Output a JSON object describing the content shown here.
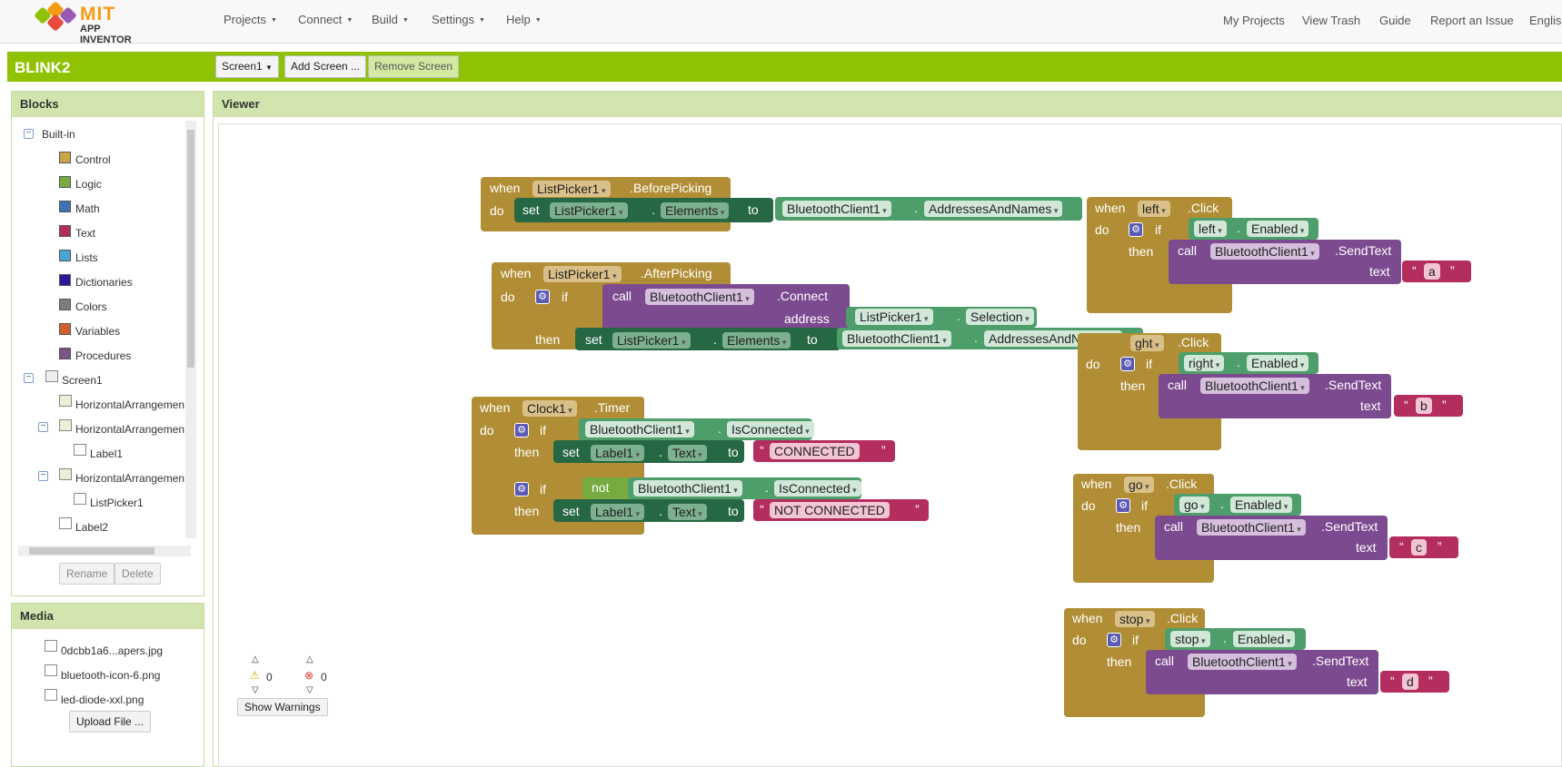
{
  "app": {
    "logo_line1": "MIT",
    "logo_line2": "APP INVENTOR"
  },
  "menu": [
    "Projects",
    "Connect",
    "Build",
    "Settings",
    "Help"
  ],
  "right_links": [
    "My Projects",
    "View Trash",
    "Guide",
    "Report an Issue",
    "English"
  ],
  "project": {
    "name": "BLINK2",
    "screen_select": "Screen1",
    "add_screen": "Add Screen ...",
    "remove_screen": "Remove Screen"
  },
  "blocks_panel": {
    "title": "Blocks",
    "builtin": "Built-in",
    "categories": [
      {
        "label": "Control",
        "color": "#c9a545"
      },
      {
        "label": "Logic",
        "color": "#77ab41"
      },
      {
        "label": "Math",
        "color": "#3f71b5"
      },
      {
        "label": "Text",
        "color": "#b32d5e"
      },
      {
        "label": "Lists",
        "color": "#49a6d4"
      },
      {
        "label": "Dictionaries",
        "color": "#2d1799"
      },
      {
        "label": "Colors",
        "color": "#7d7d7d"
      },
      {
        "label": "Variables",
        "color": "#d05f2d"
      },
      {
        "label": "Procedures",
        "color": "#7c5385"
      }
    ],
    "components": [
      {
        "label": "Screen1"
      },
      {
        "label": "HorizontalArrangemen"
      },
      {
        "label": "HorizontalArrangemen"
      },
      {
        "label": "Label1"
      },
      {
        "label": "HorizontalArrangemen"
      },
      {
        "label": "ListPicker1"
      },
      {
        "label": "Label2"
      }
    ],
    "rename": "Rename",
    "delete": "Delete"
  },
  "media_panel": {
    "title": "Media",
    "files": [
      "0dcbb1a6...apers.jpg",
      "bluetooth-icon-6.png",
      "led-diode-xxl.png"
    ],
    "upload": "Upload File ..."
  },
  "viewer": {
    "title": "Viewer"
  },
  "warnings": {
    "warn_count": "0",
    "error_count": "0",
    "show_warnings": "Show Warnings"
  },
  "blocks": {
    "when": "when",
    "do": "do",
    "set": "set",
    "to": "to",
    "if": "if",
    "then": "then",
    "call": "call",
    "not": "not",
    "address": "address",
    "text": "text",
    "listpicker1": "ListPicker1",
    "beforepicking": ".BeforePicking",
    "afterpicking": ".AfterPicking",
    "elements": "Elements",
    "bt": "BluetoothClient1",
    "addrnames": "AddressesAndNames",
    "connect": ".Connect",
    "selection": "Selection",
    "clock1": "Clock1",
    "timer": ".Timer",
    "isconnected": "IsConnected",
    "label1": "Label1",
    "textprop": "Text",
    "connected": "CONNECTED",
    "notconnected": "NOT CONNECTED",
    "left": "left",
    "right": "right",
    "right_partial": "ght",
    "go": "go",
    "stop": "stop",
    "click": ".Click",
    "enabled": "Enabled",
    "sendtext": ".SendText",
    "a": "a",
    "b": "b",
    "c": "c",
    "d": "d",
    "dot": "."
  }
}
